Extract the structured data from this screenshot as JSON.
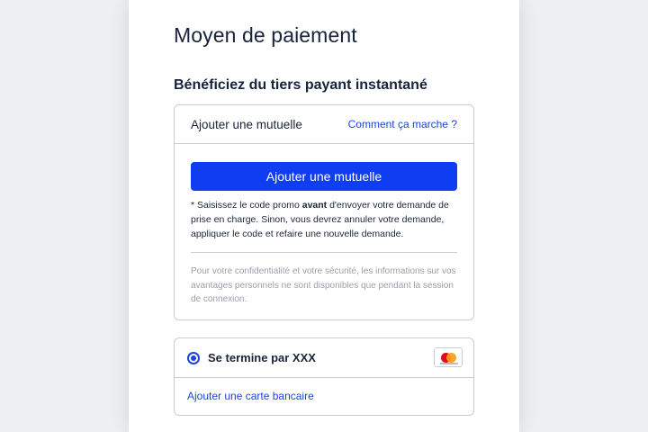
{
  "page": {
    "title": "Moyen de paiement",
    "section_title": "Bénéficiez du tiers payant instantané"
  },
  "mutuelle": {
    "header_title": "Ajouter une mutuelle",
    "how_it_works_link": "Comment ça marche ?",
    "button_label": "Ajouter une mutuelle",
    "promo_note_prefix": "* Saisissez le code promo ",
    "promo_note_bold": "avant",
    "promo_note_suffix": " d'envoyer votre demande de prise en charge. Sinon, vous devrez annuler votre demande, appliquer le code et refaire une nouvelle demande.",
    "privacy_note": "Pour votre confidentialité et votre sécurité, les informations sur vos avantages personnels ne sont disponibles que pendant la session de connexion."
  },
  "payment": {
    "card_label": "Se termine par XXX",
    "card_brand_icon": "mastercard-icon",
    "selected": true,
    "add_card_link": "Ajouter une carte bancaire"
  },
  "colors": {
    "accent": "#0f3df2",
    "link": "#1b46d8",
    "border": "#c9cdd6",
    "background": "#edeff2",
    "muted_text": "#9aa0ab"
  }
}
